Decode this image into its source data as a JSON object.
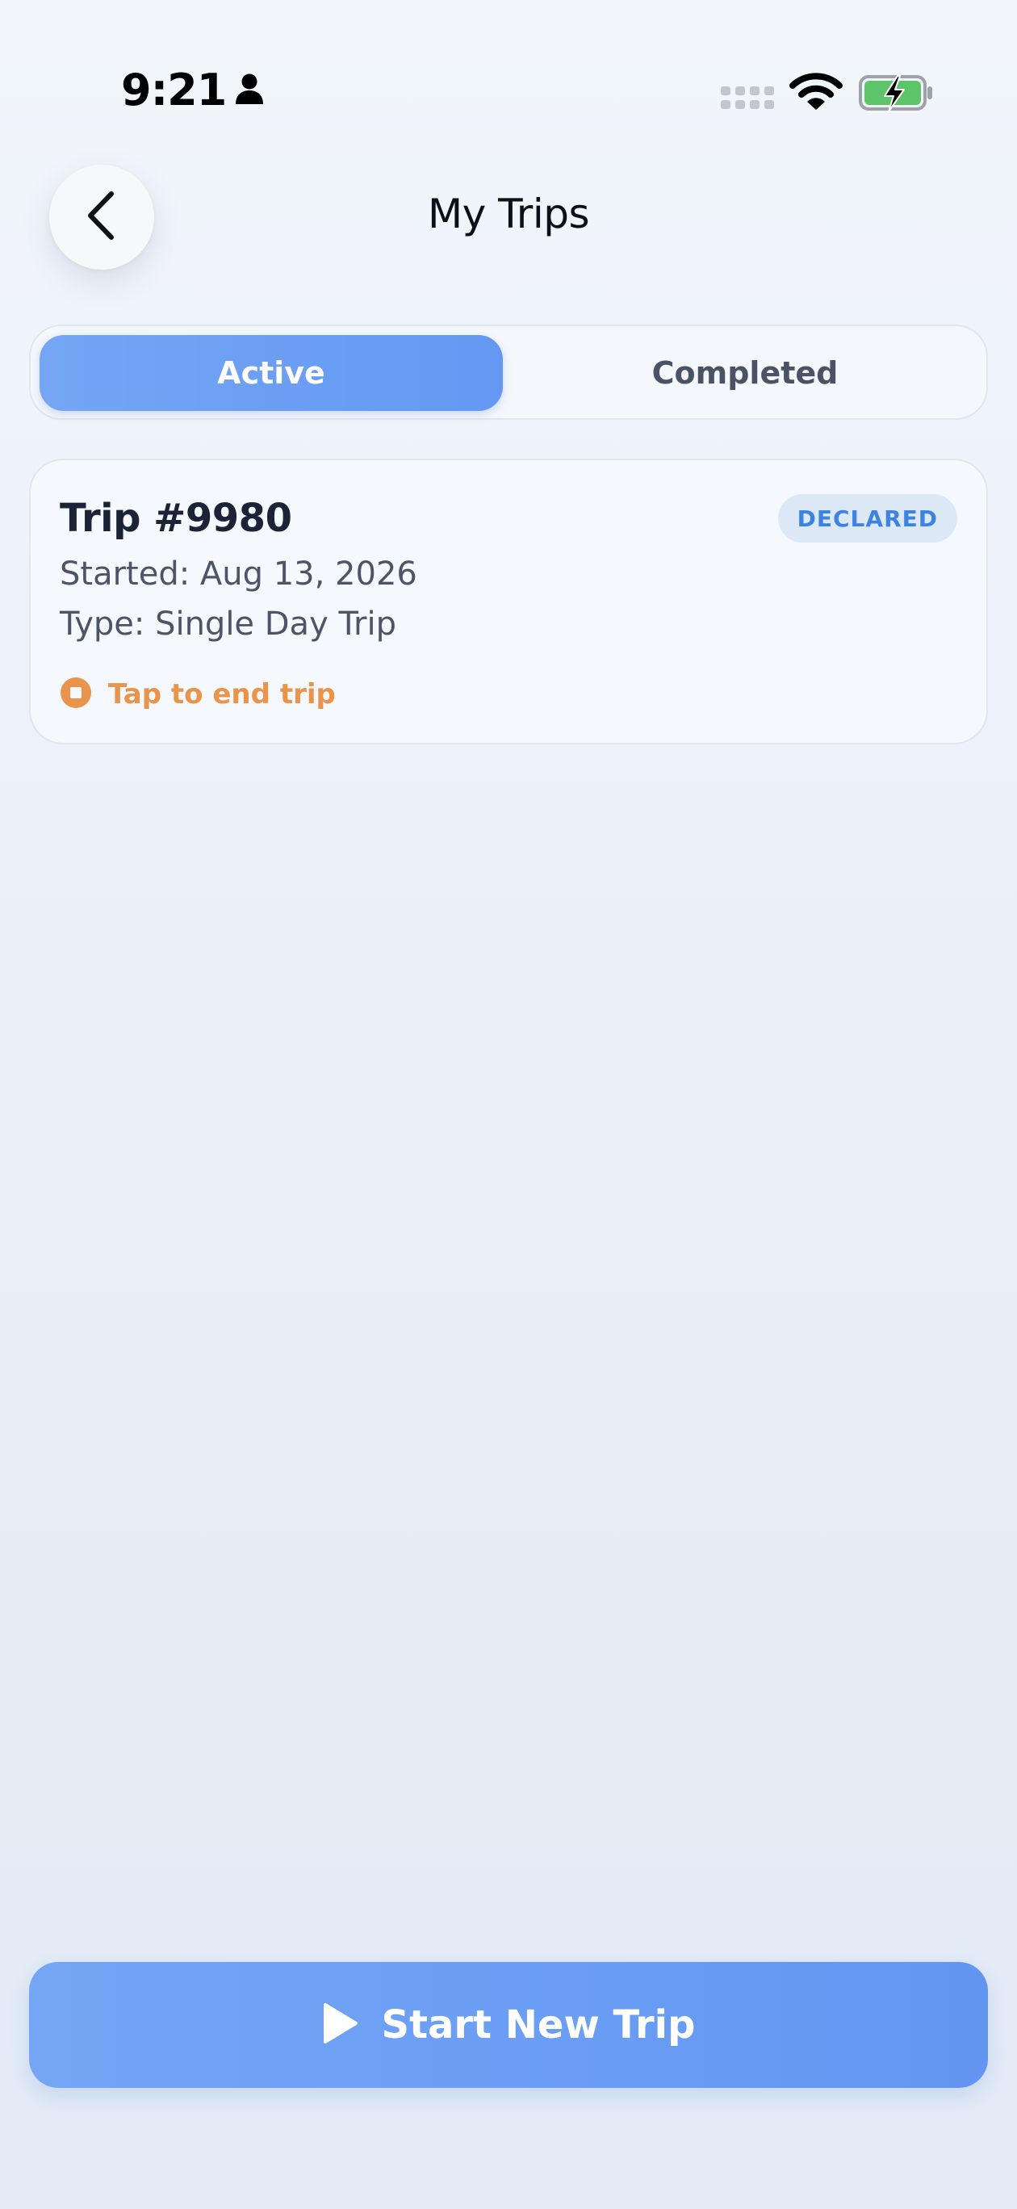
{
  "status_bar": {
    "time": "9:21",
    "icons": [
      "person-icon",
      "cellular-signal-icon",
      "wifi-icon",
      "battery-charging-icon"
    ]
  },
  "header": {
    "title": "My Trips",
    "back_icon": "chevron-left-icon"
  },
  "tabs": [
    {
      "label": "Active",
      "selected": true
    },
    {
      "label": "Completed",
      "selected": false
    }
  ],
  "trips": [
    {
      "title": "Trip #9980",
      "status": "DECLARED",
      "started": "Started: Aug 13, 2026",
      "type": "Type: Single Day Trip",
      "action": "Tap to end trip",
      "action_icon": "stop-circle-icon"
    }
  ],
  "footer": {
    "start_label": "Start New Trip",
    "start_icon": "play-icon"
  },
  "colors": {
    "accent": "#6a9ff4",
    "badge_text": "#3f83e0",
    "badge_bg": "#dde8f6",
    "warning": "#ea934a",
    "battery_fill": "#5ec46a"
  }
}
